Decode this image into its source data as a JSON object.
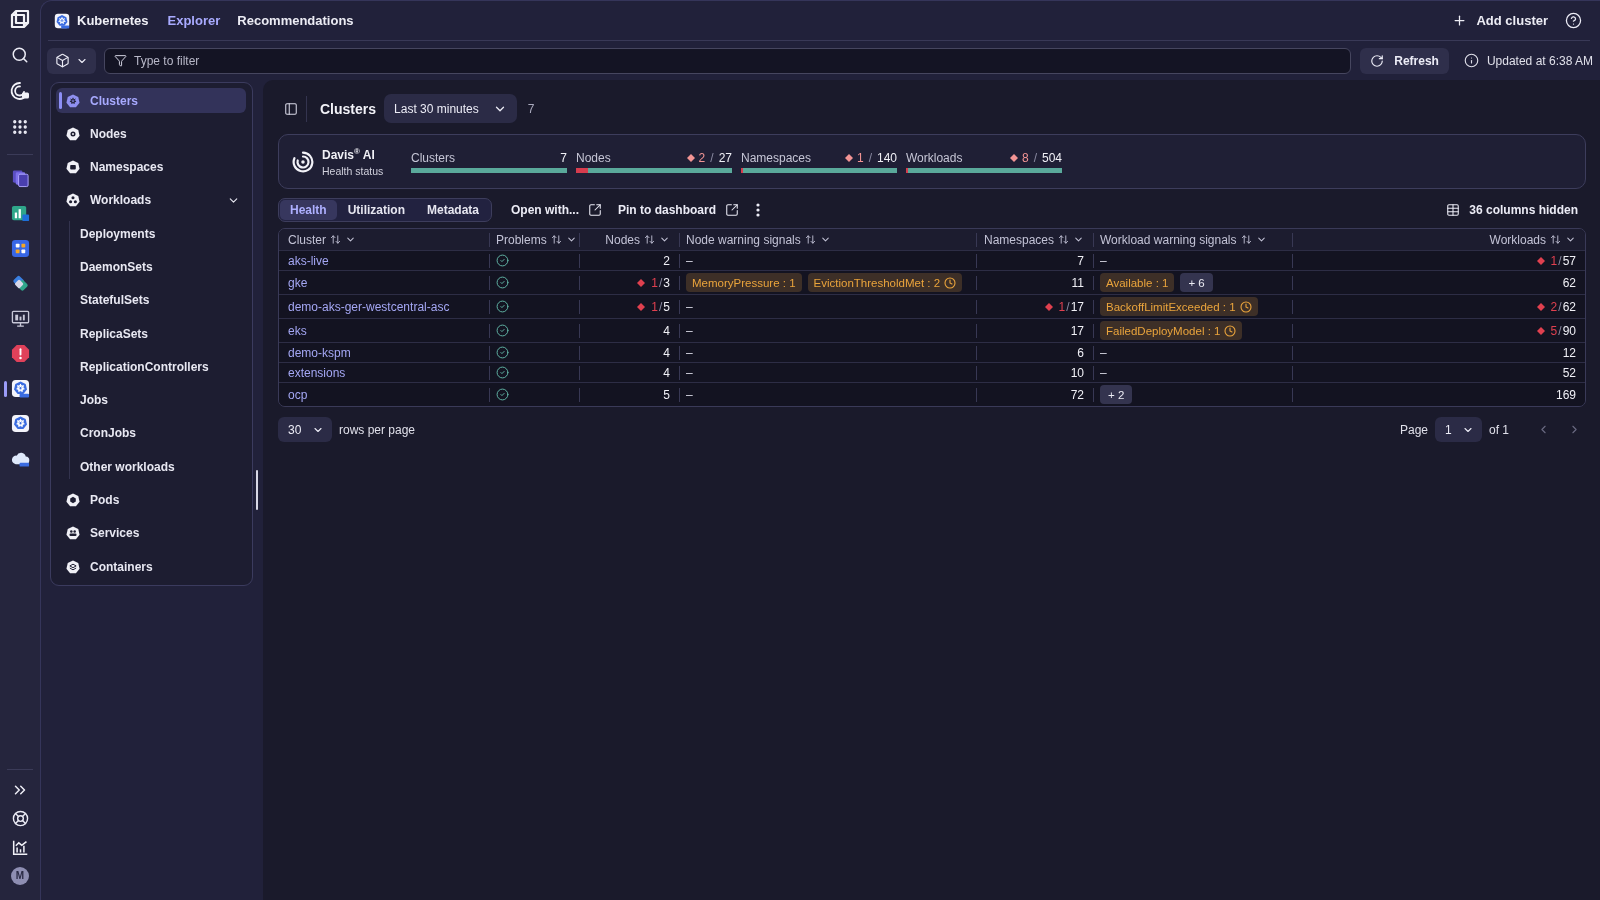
{
  "rail": {
    "apps": [
      {
        "selected": false
      },
      {
        "selected": false
      },
      {
        "selected": false
      },
      {
        "selected": false
      },
      {
        "selected": false
      },
      {
        "selected": false
      },
      {
        "selected": true
      },
      {
        "selected": false
      },
      {
        "selected": false
      }
    ],
    "avatar": "M"
  },
  "top_bar": {
    "app_title": "Kubernetes",
    "nav": [
      {
        "label": "Explorer",
        "selected": true
      },
      {
        "label": "Recommendations",
        "selected": false
      }
    ],
    "add_button": "Add cluster"
  },
  "filter_bar": {
    "placeholder": "Type to filter",
    "refresh_button": "Refresh",
    "updated": "Updated at 6:38 AM"
  },
  "sidebar": {
    "items": [
      {
        "label": "Clusters",
        "selected": true
      },
      {
        "label": "Nodes",
        "selected": false
      },
      {
        "label": "Namespaces",
        "selected": false
      },
      {
        "label": "Workloads",
        "selected": false,
        "expanded": true,
        "children": [
          {
            "label": "Deployments",
            "selected": false
          },
          {
            "label": "DaemonSets",
            "selected": false
          },
          {
            "label": "StatefulSets",
            "selected": false
          },
          {
            "label": "ReplicaSets",
            "selected": false
          },
          {
            "label": "ReplicationControllers",
            "selected": false
          },
          {
            "label": "Jobs",
            "selected": false
          },
          {
            "label": "CronJobs",
            "selected": false
          },
          {
            "label": "Other workloads",
            "selected": false
          }
        ]
      },
      {
        "label": "Pods",
        "selected": false
      },
      {
        "label": "Services",
        "selected": false
      },
      {
        "label": "Containers",
        "selected": false
      }
    ]
  },
  "header": {
    "title": "Clusters",
    "timeframe": "Last 30 minutes",
    "count": "7"
  },
  "health_summary": {
    "title": "Davis$^{®}$ AI",
    "subtitle": "Health status",
    "stats": [
      {
        "label": "Clusters",
        "value": "7"
      },
      {
        "label": "Nodes",
        "problems": "2",
        "separator": "/",
        "value": "27",
        "level": 0.074
      },
      {
        "label": "Namespaces",
        "problems": "1",
        "separator": "/",
        "value": "140",
        "level": 0.007
      },
      {
        "label": "Workloads",
        "problems": "8",
        "separator": "/",
        "value": "504",
        "level": 0.016
      }
    ]
  },
  "view_tabs": [
    {
      "label": "Health",
      "selected": true
    },
    {
      "label": "Utilization",
      "selected": false
    },
    {
      "label": "Metadata",
      "selected": false
    }
  ],
  "actions": [
    {
      "kind": "link",
      "label": "Open with..."
    },
    {
      "kind": "link",
      "label": "Pin to dashboard"
    },
    {
      "kind": "menu"
    }
  ],
  "hidden_columns": "36 columns hidden",
  "table": {
    "columns": [
      {
        "label": "Cluster",
        "kind": "name"
      },
      {
        "label": "Problems",
        "kind": "status"
      },
      {
        "label": "Nodes",
        "kind": "count"
      },
      {
        "label": "Node warning signals",
        "kind": "signals"
      },
      {
        "label": "Namespaces",
        "kind": "count"
      },
      {
        "label": "Workload warning signals",
        "kind": "signals"
      },
      {
        "label": "Workloads",
        "kind": "count"
      }
    ],
    "rows": [
      {
        "cells": [
          {
            "kind": "name",
            "text": "aks-live"
          },
          {
            "kind": "status",
            "healthy": true
          },
          {
            "kind": "count",
            "value": "2"
          },
          {
            "kind": "signals",
            "chips": [
              {
                "kind": "none",
                "text": "–"
              }
            ]
          },
          {
            "kind": "count",
            "value": "7"
          },
          {
            "kind": "signals",
            "chips": [
              {
                "kind": "none",
                "text": "–"
              }
            ]
          },
          {
            "kind": "count",
            "problems": "1",
            "separator": "/",
            "value": "57"
          }
        ]
      },
      {
        "cells": [
          {
            "kind": "name",
            "text": "gke"
          },
          {
            "kind": "status",
            "healthy": true
          },
          {
            "kind": "count",
            "problems": "1",
            "separator": "/",
            "value": "3"
          },
          {
            "kind": "signals",
            "chips": [
              {
                "kind": "signal",
                "text": "MemoryPressure : 1",
                "clock": false
              },
              {
                "kind": "signal",
                "text": "EvictionThresholdMet : 2",
                "clock": true
              }
            ]
          },
          {
            "kind": "count",
            "value": "11"
          },
          {
            "kind": "signals",
            "chips": [
              {
                "kind": "signal",
                "text": "Available : 1",
                "clock": false
              },
              {
                "kind": "more",
                "text": "+ 6"
              }
            ]
          },
          {
            "kind": "count",
            "value": "62"
          }
        ]
      },
      {
        "cells": [
          {
            "kind": "name",
            "text": "demo-aks-ger-westcentral-asc"
          },
          {
            "kind": "status",
            "healthy": true
          },
          {
            "kind": "count",
            "problems": "1",
            "separator": "/",
            "value": "5"
          },
          {
            "kind": "signals",
            "chips": [
              {
                "kind": "none",
                "text": "–"
              }
            ]
          },
          {
            "kind": "count",
            "problems": "1",
            "separator": "/",
            "value": "17"
          },
          {
            "kind": "signals",
            "chips": [
              {
                "kind": "signal",
                "text": "BackoffLimitExceeded : 1",
                "clock": true
              }
            ]
          },
          {
            "kind": "count",
            "problems": "2",
            "separator": "/",
            "value": "62"
          }
        ]
      },
      {
        "cells": [
          {
            "kind": "name",
            "text": "eks"
          },
          {
            "kind": "status",
            "healthy": true
          },
          {
            "kind": "count",
            "value": "4"
          },
          {
            "kind": "signals",
            "chips": [
              {
                "kind": "none",
                "text": "–"
              }
            ]
          },
          {
            "kind": "count",
            "value": "17"
          },
          {
            "kind": "signals",
            "chips": [
              {
                "kind": "signal",
                "text": "FailedDeployModel : 1",
                "clock": true
              }
            ]
          },
          {
            "kind": "count",
            "problems": "5",
            "separator": "/",
            "value": "90"
          }
        ]
      },
      {
        "cells": [
          {
            "kind": "name",
            "text": "demo-kspm"
          },
          {
            "kind": "status",
            "healthy": true
          },
          {
            "kind": "count",
            "value": "4"
          },
          {
            "kind": "signals",
            "chips": [
              {
                "kind": "none",
                "text": "–"
              }
            ]
          },
          {
            "kind": "count",
            "value": "6"
          },
          {
            "kind": "signals",
            "chips": [
              {
                "kind": "none",
                "text": "–"
              }
            ]
          },
          {
            "kind": "count",
            "value": "12"
          }
        ]
      },
      {
        "cells": [
          {
            "kind": "name",
            "text": "extensions"
          },
          {
            "kind": "status",
            "healthy": true
          },
          {
            "kind": "count",
            "value": "4"
          },
          {
            "kind": "signals",
            "chips": [
              {
                "kind": "none",
                "text": "–"
              }
            ]
          },
          {
            "kind": "count",
            "value": "10"
          },
          {
            "kind": "signals",
            "chips": [
              {
                "kind": "none",
                "text": "–"
              }
            ]
          },
          {
            "kind": "count",
            "value": "52"
          }
        ]
      },
      {
        "cells": [
          {
            "kind": "name",
            "text": "ocp"
          },
          {
            "kind": "status",
            "healthy": true
          },
          {
            "kind": "count",
            "value": "5"
          },
          {
            "kind": "signals",
            "chips": [
              {
                "kind": "none",
                "text": "–"
              }
            ]
          },
          {
            "kind": "count",
            "value": "72"
          },
          {
            "kind": "signals",
            "chips": [
              {
                "kind": "more",
                "text": "+ 2"
              }
            ]
          },
          {
            "kind": "count",
            "value": "169"
          }
        ]
      }
    ]
  },
  "pagination": {
    "rows_per_page": "30",
    "rows_label": "rows per page",
    "page_label": "Page",
    "page": "1",
    "of_label": "of 1",
    "prev": {
      "disabled": true
    },
    "next": {
      "disabled": true
    }
  }
}
